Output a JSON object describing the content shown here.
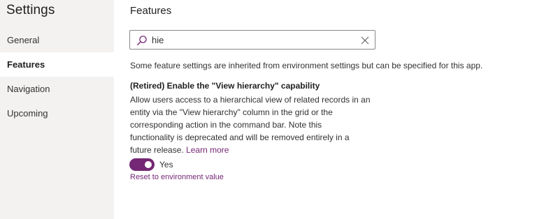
{
  "sidebar": {
    "title": "Settings",
    "items": [
      {
        "label": "General",
        "active": false
      },
      {
        "label": "Features",
        "active": true
      },
      {
        "label": "Navigation",
        "active": false
      },
      {
        "label": "Upcoming",
        "active": false
      }
    ]
  },
  "main": {
    "title": "Features",
    "search": {
      "value": "hie",
      "icon": "search-icon",
      "clear_icon": "close-icon"
    },
    "info_text": "Some feature settings are inherited from environment settings but can be specified for this app.",
    "feature": {
      "heading": "(Retired) Enable the \"View hierarchy\" capability",
      "description_lines": [
        "Allow users access to a hierarchical view of related records in an",
        "entity via the \"View hierarchy\" column in the grid or the",
        "corresponding action in the command bar. Note this",
        "functionality is deprecated and will be removed entirely in a",
        "future release."
      ],
      "learn_more": "Learn more",
      "toggle": {
        "on": true,
        "label": "Yes"
      },
      "reset_link": "Reset to environment value"
    }
  },
  "colors": {
    "accent": "#742774",
    "sidebar_bg": "#f3f2f1",
    "border": "#8a8886"
  }
}
